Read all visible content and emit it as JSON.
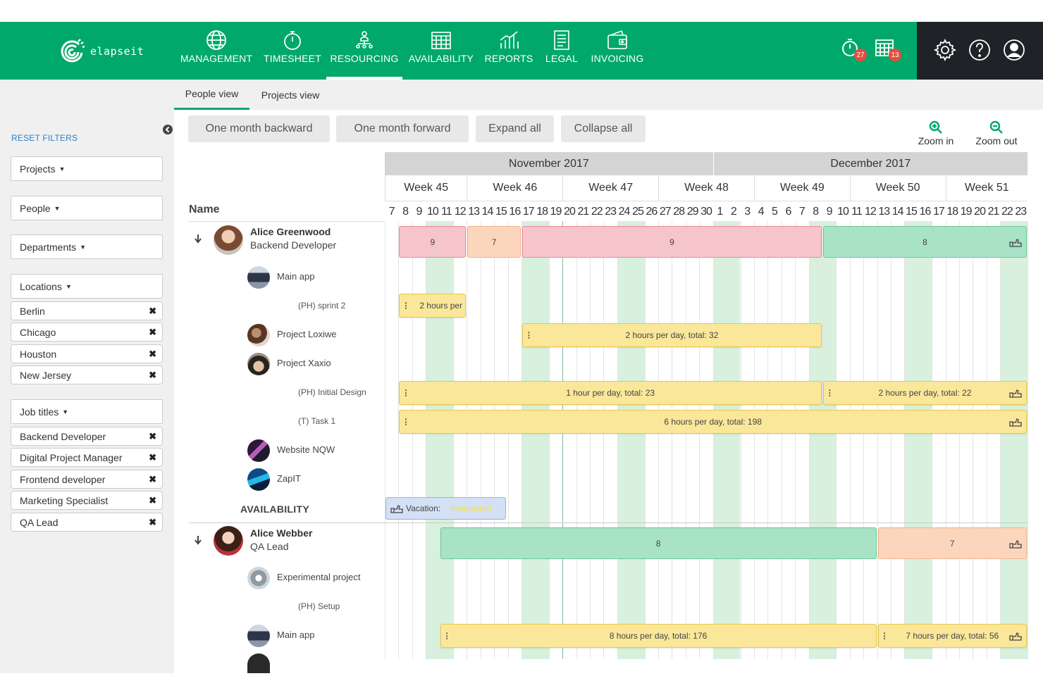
{
  "app": {
    "logo_text": "elapseit"
  },
  "nav": {
    "items": [
      {
        "label": "MANAGEMENT",
        "icon": "globe-icon"
      },
      {
        "label": "TIMESHEET",
        "icon": "stopwatch-icon"
      },
      {
        "label": "RESOURCING",
        "icon": "org-chart-icon"
      },
      {
        "label": "AVAILABILITY",
        "icon": "calendar-grid-icon"
      },
      {
        "label": "REPORTS",
        "icon": "bar-chart-icon"
      },
      {
        "label": "LEGAL",
        "icon": "document-icon"
      },
      {
        "label": "INVOICING",
        "icon": "wallet-icon"
      }
    ],
    "active": "RESOURCING",
    "notifications": {
      "timesheet_count": "27",
      "calendar_count": "13"
    },
    "right_icons": [
      "gear-icon",
      "help-icon",
      "user-icon"
    ]
  },
  "subnav": {
    "tabs": [
      "People view",
      "Projects view"
    ],
    "active": "People view"
  },
  "sidebar": {
    "reset_label": "RESET FILTERS",
    "filters": {
      "projects": "Projects",
      "people": "People",
      "departments": "Departments",
      "locations": "Locations",
      "job_titles": "Job titles"
    },
    "location_chips": [
      "Berlin",
      "Chicago",
      "Houston",
      "New Jersey"
    ],
    "job_title_chips": [
      "Backend Developer",
      "Digital Project Manager",
      "Frontend developer",
      "Marketing Specialist",
      "QA Lead"
    ]
  },
  "toolbar": {
    "back": "One month backward",
    "forward": "One month forward",
    "expand": "Expand all",
    "collapse": "Collapse all",
    "zoom_in": "Zoom in",
    "zoom_out": "Zoom out"
  },
  "gantt": {
    "name_header": "Name",
    "availability_label": "AVAILABILITY",
    "months": [
      "November 2017",
      "December 2017"
    ],
    "weeks": [
      "Week 45",
      "Week 46",
      "Week 47",
      "Week 48",
      "Week 49",
      "Week 50",
      "Week 51"
    ],
    "days": [
      "7",
      "8",
      "9",
      "10",
      "11",
      "12",
      "13",
      "14",
      "15",
      "16",
      "17",
      "18",
      "19",
      "20",
      "21",
      "22",
      "23",
      "24",
      "25",
      "26",
      "27",
      "28",
      "29",
      "30",
      "1",
      "2",
      "3",
      "4",
      "5",
      "6",
      "7",
      "8",
      "9",
      "10",
      "11",
      "12",
      "13",
      "14",
      "15",
      "16",
      "17",
      "18",
      "19",
      "20",
      "21",
      "22",
      "23"
    ],
    "weekend_day_indices": [
      3,
      4,
      10,
      11,
      17,
      18,
      24,
      25,
      31,
      32,
      38,
      39,
      45,
      46
    ],
    "people": [
      {
        "name": "Alice Greenwood",
        "role": "Backend Developer",
        "rows": [
          {
            "kind": "project",
            "label": "Main app"
          },
          {
            "kind": "task",
            "label": "(PH) sprint 2"
          },
          {
            "kind": "project",
            "label": "Project Loxiwe"
          },
          {
            "kind": "project",
            "label": "Project Xaxio"
          },
          {
            "kind": "task",
            "label": "(PH) Initial Design"
          },
          {
            "kind": "task",
            "label": "(T) Task 1"
          },
          {
            "kind": "project",
            "label": "Website NQW"
          },
          {
            "kind": "project",
            "label": "ZapIT"
          }
        ]
      },
      {
        "name": "Alice Webber",
        "role": "QA Lead",
        "rows": [
          {
            "kind": "project",
            "label": "Experimental project"
          },
          {
            "kind": "task",
            "label": "(PH) Setup"
          },
          {
            "kind": "project",
            "label": "Main app"
          }
        ]
      }
    ],
    "bars": [
      {
        "row": "p1-summary",
        "color": "red",
        "label": "9",
        "start": 1,
        "end": 6
      },
      {
        "row": "p1-summary",
        "color": "orange",
        "label": "7",
        "start": 6,
        "end": 10
      },
      {
        "row": "p1-summary",
        "color": "red",
        "label": "9",
        "start": 10,
        "end": 32
      },
      {
        "row": "p1-summary",
        "color": "green",
        "label": "8",
        "start": 32,
        "end": 47,
        "hand": true
      },
      {
        "row": "p1-sprint2",
        "color": "yellow",
        "label": "2 hours per",
        "start": 1,
        "end": 6,
        "grip": true
      },
      {
        "row": "p1-loxiwe",
        "color": "yellow",
        "label": "2 hours per day, total: 32",
        "start": 10,
        "end": 32,
        "grip": true
      },
      {
        "row": "p1-initial",
        "color": "yellow",
        "label": "1 hour per day, total: 23",
        "start": 1,
        "end": 32,
        "grip": true
      },
      {
        "row": "p1-initial",
        "color": "yellow",
        "label": "2 hours per day, total: 22",
        "start": 32,
        "end": 47,
        "grip": true,
        "hand": true
      },
      {
        "row": "p1-task1",
        "color": "yellow",
        "label": "6 hours per day, total: 198",
        "start": 1,
        "end": 47,
        "grip": true,
        "hand": true
      },
      {
        "row": "p2-summary",
        "color": "green",
        "label": "8",
        "start": 4,
        "end": 36
      },
      {
        "row": "p2-summary",
        "color": "orange",
        "label": "7",
        "start": 36,
        "end": 47,
        "hand": true
      },
      {
        "row": "p2-mainapp",
        "color": "yellow",
        "label": "8 hours per day, total: 176",
        "start": 4,
        "end": 36,
        "grip": true
      },
      {
        "row": "p2-mainapp",
        "color": "yellow",
        "label": "7 hours per day, total: 56",
        "start": 36,
        "end": 47,
        "grip": true,
        "hand": true
      }
    ],
    "vacation": {
      "label": "Vacation:",
      "status": "Requested",
      "start": 0,
      "end": 9
    }
  },
  "colors": {
    "brand_green": "#00a86b",
    "dark_header": "#1f2327",
    "weekend": "#d7f1dd",
    "red_bar": "#f6c4cb",
    "orange_bar": "#fbd6bd",
    "green_bar": "#a8e3c6",
    "yellow_bar": "#fae79a",
    "vacation_bar": "#d3e0f5"
  }
}
